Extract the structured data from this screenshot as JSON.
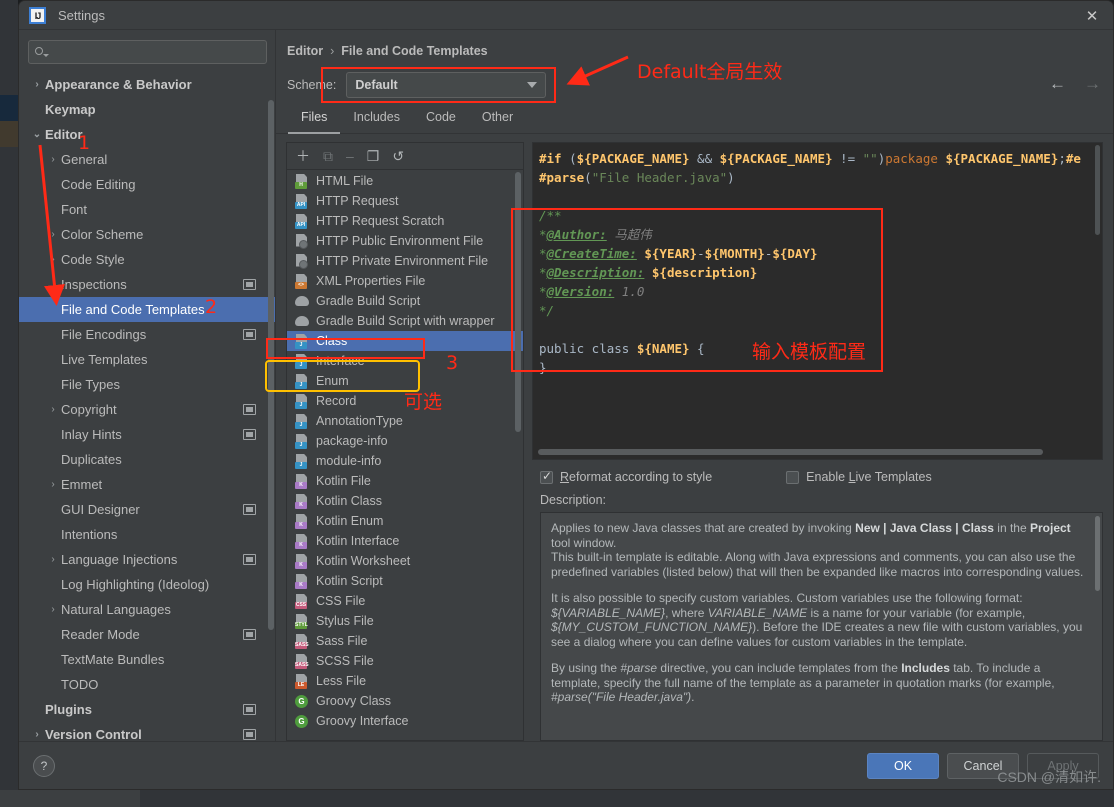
{
  "window": {
    "title": "Settings",
    "logo_text": "IJ",
    "close_icon": "close-icon"
  },
  "sidebar": {
    "search_placeholder": "",
    "items": [
      {
        "label": "Appearance & Behavior",
        "level": 1,
        "twisty": "›",
        "bold": true,
        "badge": false,
        "selected": false
      },
      {
        "label": "Keymap",
        "level": 1,
        "twisty": "",
        "bold": true,
        "badge": false,
        "selected": false
      },
      {
        "label": "Editor",
        "level": 1,
        "twisty": "⌄",
        "bold": true,
        "badge": false,
        "selected": false
      },
      {
        "label": "General",
        "level": 2,
        "twisty": "›",
        "bold": false,
        "badge": false,
        "selected": false
      },
      {
        "label": "Code Editing",
        "level": 2,
        "twisty": "",
        "bold": false,
        "badge": false,
        "selected": false
      },
      {
        "label": "Font",
        "level": 2,
        "twisty": "",
        "bold": false,
        "badge": false,
        "selected": false
      },
      {
        "label": "Color Scheme",
        "level": 2,
        "twisty": "›",
        "bold": false,
        "badge": false,
        "selected": false
      },
      {
        "label": "Code Style",
        "level": 2,
        "twisty": "›",
        "bold": false,
        "badge": false,
        "selected": false
      },
      {
        "label": "Inspections",
        "level": 2,
        "twisty": "",
        "bold": false,
        "badge": true,
        "selected": false
      },
      {
        "label": "File and Code Templates",
        "level": 2,
        "twisty": "",
        "bold": false,
        "badge": false,
        "selected": true
      },
      {
        "label": "File Encodings",
        "level": 2,
        "twisty": "",
        "bold": false,
        "badge": true,
        "selected": false
      },
      {
        "label": "Live Templates",
        "level": 2,
        "twisty": "",
        "bold": false,
        "badge": false,
        "selected": false
      },
      {
        "label": "File Types",
        "level": 2,
        "twisty": "",
        "bold": false,
        "badge": false,
        "selected": false
      },
      {
        "label": "Copyright",
        "level": 2,
        "twisty": "›",
        "bold": false,
        "badge": true,
        "selected": false
      },
      {
        "label": "Inlay Hints",
        "level": 2,
        "twisty": "",
        "bold": false,
        "badge": true,
        "selected": false
      },
      {
        "label": "Duplicates",
        "level": 2,
        "twisty": "",
        "bold": false,
        "badge": false,
        "selected": false
      },
      {
        "label": "Emmet",
        "level": 2,
        "twisty": "›",
        "bold": false,
        "badge": false,
        "selected": false
      },
      {
        "label": "GUI Designer",
        "level": 2,
        "twisty": "",
        "bold": false,
        "badge": true,
        "selected": false
      },
      {
        "label": "Intentions",
        "level": 2,
        "twisty": "",
        "bold": false,
        "badge": false,
        "selected": false
      },
      {
        "label": "Language Injections",
        "level": 2,
        "twisty": "›",
        "bold": false,
        "badge": true,
        "selected": false
      },
      {
        "label": "Log Highlighting (Ideolog)",
        "level": 2,
        "twisty": "",
        "bold": false,
        "badge": false,
        "selected": false
      },
      {
        "label": "Natural Languages",
        "level": 2,
        "twisty": "›",
        "bold": false,
        "badge": false,
        "selected": false
      },
      {
        "label": "Reader Mode",
        "level": 2,
        "twisty": "",
        "bold": false,
        "badge": true,
        "selected": false
      },
      {
        "label": "TextMate Bundles",
        "level": 2,
        "twisty": "",
        "bold": false,
        "badge": false,
        "selected": false
      },
      {
        "label": "TODO",
        "level": 2,
        "twisty": "",
        "bold": false,
        "badge": false,
        "selected": false
      },
      {
        "label": "Plugins",
        "level": 1,
        "twisty": "",
        "bold": true,
        "badge": true,
        "selected": false
      },
      {
        "label": "Version Control",
        "level": 1,
        "twisty": "›",
        "bold": true,
        "badge": true,
        "selected": false
      }
    ]
  },
  "main": {
    "breadcrumb": {
      "parent": "Editor",
      "separator": "›",
      "current": "File and Code Templates"
    },
    "nav": {
      "back_icon": "arrow-left-icon",
      "forward_icon": "arrow-right-icon"
    },
    "scheme": {
      "label": "Scheme:",
      "value": "Default"
    },
    "tabs": [
      {
        "label": "Files",
        "active": true
      },
      {
        "label": "Includes",
        "active": false
      },
      {
        "label": "Code",
        "active": false
      },
      {
        "label": "Other",
        "active": false
      }
    ],
    "toolbar": [
      {
        "icon": "plus-icon",
        "glyph": "＋",
        "enabled": true
      },
      {
        "icon": "copy-file-icon",
        "glyph": "⧉",
        "enabled": false
      },
      {
        "icon": "minus-icon",
        "glyph": "–",
        "enabled": false
      },
      {
        "icon": "duplicate-icon",
        "glyph": "❐",
        "enabled": true
      },
      {
        "icon": "reset-icon",
        "glyph": "↺",
        "enabled": true
      }
    ],
    "templates": [
      {
        "label": "HTML File",
        "icon": "html-file-icon",
        "tag": "H",
        "color": "#5f9c3a",
        "selected": false
      },
      {
        "label": "HTTP Request",
        "icon": "http-request-icon",
        "tag": "API",
        "color": "#3592c4",
        "selected": false
      },
      {
        "label": "HTTP Request Scratch",
        "icon": "http-request-icon",
        "tag": "API",
        "color": "#3592c4",
        "selected": false
      },
      {
        "label": "HTTP Public Environment File",
        "icon": "http-env-icon",
        "tag": "",
        "color": "#6f7477",
        "selected": false
      },
      {
        "label": "HTTP Private Environment File",
        "icon": "http-env-icon",
        "tag": "",
        "color": "#6f7477",
        "selected": false
      },
      {
        "label": "XML Properties File",
        "icon": "xml-file-icon",
        "tag": "<>",
        "color": "#cc7832",
        "selected": false
      },
      {
        "label": "Gradle Build Script",
        "icon": "gradle-icon",
        "tag": "",
        "color": "#9ea2a5",
        "selected": false
      },
      {
        "label": "Gradle Build Script with wrapper",
        "icon": "gradle-icon",
        "tag": "",
        "color": "#9ea2a5",
        "selected": false
      },
      {
        "label": "Class",
        "icon": "java-class-icon",
        "tag": "J",
        "color": "#3592c4",
        "selected": true
      },
      {
        "label": "Interface",
        "icon": "java-class-icon",
        "tag": "J",
        "color": "#3592c4",
        "selected": false
      },
      {
        "label": "Enum",
        "icon": "java-class-icon",
        "tag": "J",
        "color": "#3592c4",
        "selected": false
      },
      {
        "label": "Record",
        "icon": "java-class-icon",
        "tag": "J",
        "color": "#3592c4",
        "selected": false
      },
      {
        "label": "AnnotationType",
        "icon": "java-class-icon",
        "tag": "J",
        "color": "#3592c4",
        "selected": false
      },
      {
        "label": "package-info",
        "icon": "java-class-icon",
        "tag": "J",
        "color": "#3592c4",
        "selected": false
      },
      {
        "label": "module-info",
        "icon": "java-class-icon",
        "tag": "J",
        "color": "#3592c4",
        "selected": false
      },
      {
        "label": "Kotlin File",
        "icon": "kotlin-file-icon",
        "tag": "K",
        "color": "#a97bc7",
        "selected": false
      },
      {
        "label": "Kotlin Class",
        "icon": "kotlin-file-icon",
        "tag": "K",
        "color": "#a97bc7",
        "selected": false
      },
      {
        "label": "Kotlin Enum",
        "icon": "kotlin-file-icon",
        "tag": "K",
        "color": "#a97bc7",
        "selected": false
      },
      {
        "label": "Kotlin Interface",
        "icon": "kotlin-file-icon",
        "tag": "K",
        "color": "#a97bc7",
        "selected": false
      },
      {
        "label": "Kotlin Worksheet",
        "icon": "kotlin-file-icon",
        "tag": "K",
        "color": "#a97bc7",
        "selected": false
      },
      {
        "label": "Kotlin Script",
        "icon": "kotlin-file-icon",
        "tag": "K",
        "color": "#a97bc7",
        "selected": false
      },
      {
        "label": "CSS File",
        "icon": "css-file-icon",
        "tag": "CSS",
        "color": "#c45b7c",
        "selected": false
      },
      {
        "label": "Stylus File",
        "icon": "stylus-file-icon",
        "tag": "STYL",
        "color": "#5f9c3a",
        "selected": false
      },
      {
        "label": "Sass File",
        "icon": "sass-file-icon",
        "tag": "SASS",
        "color": "#c45b7c",
        "selected": false
      },
      {
        "label": "SCSS File",
        "icon": "scss-file-icon",
        "tag": "SASS",
        "color": "#c45b7c",
        "selected": false
      },
      {
        "label": "Less File",
        "icon": "less-file-icon",
        "tag": "LE",
        "color": "#cc5a2e",
        "selected": false
      },
      {
        "label": "Groovy Class",
        "icon": "groovy-class-icon",
        "tag": "G",
        "color": "#4f9c3e",
        "selected": false
      },
      {
        "label": "Groovy Interface",
        "icon": "groovy-class-icon",
        "tag": "G",
        "color": "#4f9c3e",
        "selected": false
      }
    ],
    "code": {
      "lines": [
        "#if (${PACKAGE_NAME} && ${PACKAGE_NAME} != \"\")package ${PACKAGE_NAME};#e",
        "#parse(\"File Header.java\")",
        "",
        "/**",
        "*@Author: 马超伟",
        "*@CreateTime: ${YEAR}-${MONTH}-${DAY}",
        "*@Description: ${description}",
        "*@Version: 1.0",
        "*/",
        "",
        "public class ${NAME} {",
        "}"
      ]
    },
    "options": {
      "reformat": {
        "label": "Reformat according to style",
        "checked": true,
        "mnemonic": "R"
      },
      "live_templates": {
        "label": "Enable Live Templates",
        "checked": false,
        "mnemonic": "L"
      }
    },
    "description": {
      "label": "Description:",
      "paragraphs": [
        "Applies to new Java classes that are created by invoking New | Java Class | Class in the Project tool window.\nThis built-in template is editable. Along with Java expressions and comments, you can also use the predefined variables (listed below) that will then be expanded like macros into corresponding values.",
        "It is also possible to specify custom variables. Custom variables use the following format: ${VARIABLE_NAME}, where VARIABLE_NAME is a name for your variable (for example, ${MY_CUSTOM_FUNCTION_NAME}). Before the IDE creates a new file with custom variables, you see a dialog where you can define values for custom variables in the template.",
        "By using the #parse directive, you can include templates from the Includes tab. To include a template, specify the full name of the template as a parameter in quotation marks (for example, #parse(\"File Header.java\")."
      ]
    }
  },
  "footer": {
    "help_label": "?",
    "ok_label": "OK",
    "cancel_label": "Cancel",
    "apply_label": "Apply",
    "watermark": "CSDN @清如许."
  },
  "annotations": {
    "note_default": "Default全局生效",
    "note_template": "输入模板配置",
    "note_optional": "可选",
    "step1": "1",
    "step2": "2",
    "step3": "3",
    "colors": {
      "red": "#ff2a17",
      "yellow": "#ffc000"
    }
  }
}
